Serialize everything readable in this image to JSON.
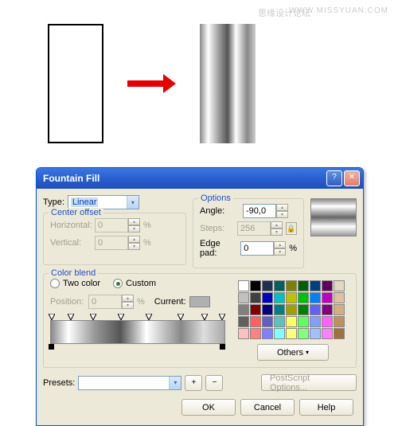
{
  "watermark": {
    "cn": "思缘设计论坛",
    "en": "WWW.MISSYUAN.COM"
  },
  "dialog": {
    "title": "Fountain Fill",
    "type_label": "Type:",
    "type_value": "Linear",
    "center_offset": {
      "title": "Center offset",
      "horizontal_label": "Horizontal:",
      "horizontal_value": "0",
      "vertical_label": "Vertical:",
      "vertical_value": "0",
      "pct": "%"
    },
    "options": {
      "title": "Options",
      "angle_label": "Angle:",
      "angle_value": "-90,0",
      "steps_label": "Steps:",
      "steps_value": "256",
      "edgepad_label": "Edge pad:",
      "edgepad_value": "0",
      "pct": "%"
    },
    "colorblend": {
      "title": "Color blend",
      "twocolor_label": "Two color",
      "custom_label": "Custom",
      "position_label": "Position:",
      "position_value": "0",
      "pct": "%",
      "current_label": "Current:",
      "others_label": "Others"
    },
    "presets": {
      "label": "Presets:",
      "value": ""
    },
    "postscript_label": "PostScript Options...",
    "buttons": {
      "ok": "OK",
      "cancel": "Cancel",
      "help": "Help"
    }
  },
  "palette_colors": [
    "#ffffff",
    "#000000",
    "#203050",
    "#006060",
    "#808000",
    "#006000",
    "#004080",
    "#600060",
    "#e0d8c0",
    "#c0c0c0",
    "#404040",
    "#0000c0",
    "#00c0c0",
    "#c0c000",
    "#00c000",
    "#0080ff",
    "#c000c0",
    "#e0c0a0",
    "#808080",
    "#800000",
    "#000080",
    "#008080",
    "#a0a000",
    "#008000",
    "#6060ff",
    "#800080",
    "#d0b080",
    "#606060",
    "#ff6060",
    "#6060c0",
    "#60c0c0",
    "#ffff60",
    "#60ff60",
    "#80a0ff",
    "#ff60ff",
    "#c09060",
    "#ffc0c0",
    "#ff8080",
    "#8080ff",
    "#80ffff",
    "#ffff80",
    "#80ff80",
    "#a0c0ff",
    "#ff80ff",
    "#a07040"
  ]
}
